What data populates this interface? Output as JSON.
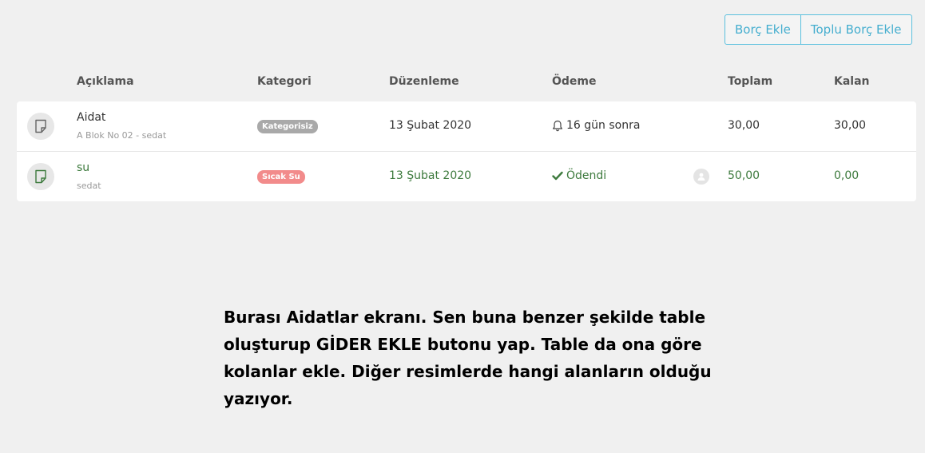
{
  "toolbar": {
    "add_debt_label": "Borç Ekle",
    "bulk_add_debt_label": "Toplu Borç Ekle"
  },
  "table": {
    "headers": {
      "description": "Açıklama",
      "category": "Kategori",
      "date": "Düzenleme",
      "payment": "Ödeme",
      "total": "Toplam",
      "remaining": "Kalan"
    },
    "rows": [
      {
        "title": "Aidat",
        "subtitle": "A Blok No 02 - sedat",
        "category": "Kategorisiz",
        "category_color": "#a9a9a9",
        "date": "13 Şubat 2020",
        "payment_icon": "bell-icon",
        "payment_status": "16 gün sonra",
        "total": "30,00",
        "remaining": "30,00"
      },
      {
        "title": "su",
        "subtitle": "sedat",
        "category": "Sıcak Su",
        "category_color": "#f28b8b",
        "date": "13 Şubat 2020",
        "payment_icon": "check-icon",
        "payment_status": "Ödendi",
        "total": "50,00",
        "remaining": "0,00"
      }
    ]
  },
  "note": {
    "text": "Burası Aidatlar ekranı. Sen buna benzer şekilde table oluşturup GİDER EKLE butonu yap. Table da ona göre kolanlar ekle. Diğer resimlerde hangi alanların olduğu yazıyor."
  },
  "colors": {
    "accent": "#5bc0de",
    "paid_green": "#3d7a3d"
  }
}
